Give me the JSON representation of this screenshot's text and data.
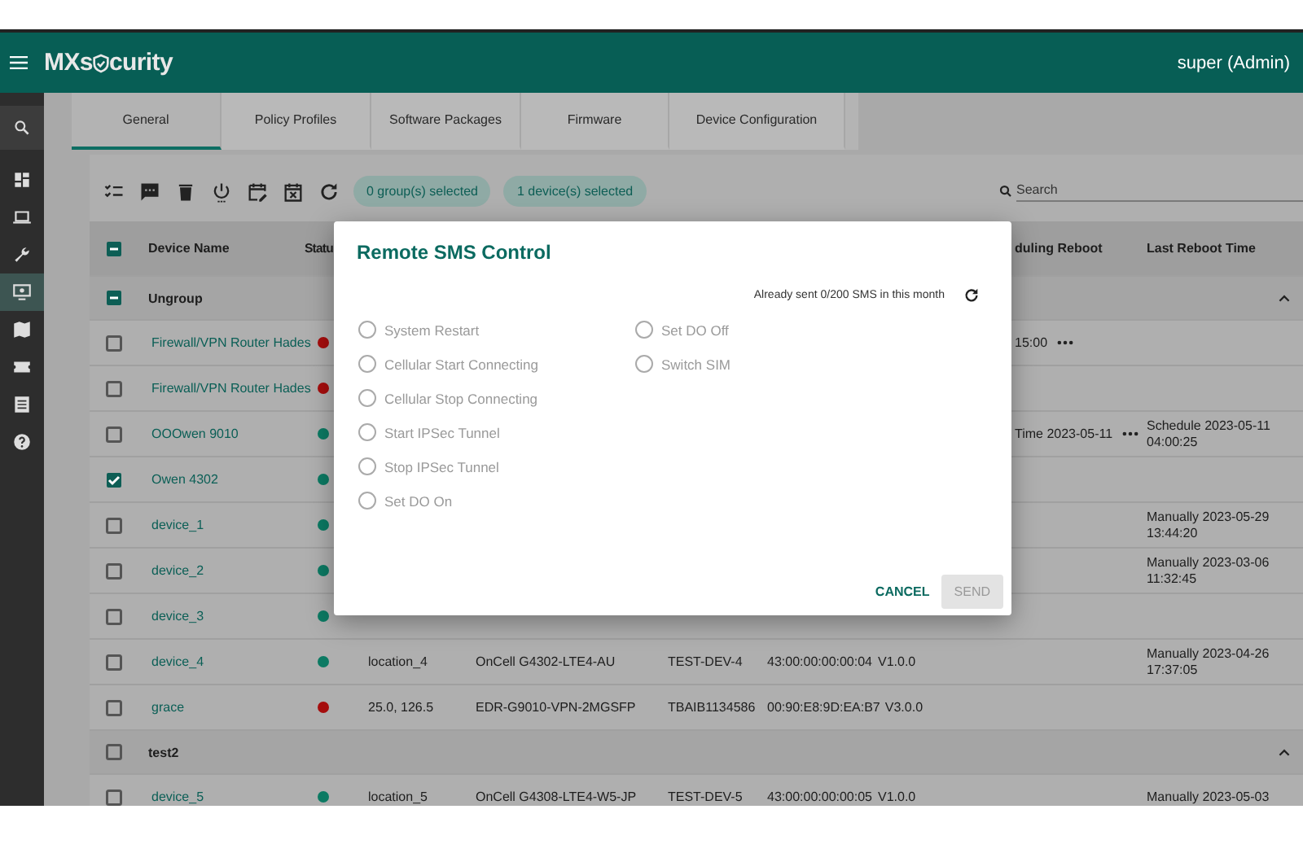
{
  "header": {
    "logo_start": "MXs",
    "logo_end": "curity",
    "user": "super (Admin)"
  },
  "sidebar": {
    "items": [
      {
        "kind": "search",
        "selected": false
      },
      {
        "kind": "dashboard",
        "selected": false
      },
      {
        "kind": "laptop",
        "selected": false
      },
      {
        "kind": "wrench",
        "selected": false
      },
      {
        "kind": "monitor",
        "selected": true
      },
      {
        "kind": "map",
        "selected": false
      },
      {
        "kind": "ticket",
        "selected": false
      },
      {
        "kind": "list",
        "selected": false
      },
      {
        "kind": "help",
        "selected": false
      }
    ]
  },
  "tabs": [
    {
      "label": "General",
      "selected": true
    },
    {
      "label": "Policy Profiles",
      "selected": false
    },
    {
      "label": "Software Packages",
      "selected": false
    },
    {
      "label": "Firmware",
      "selected": false
    },
    {
      "label": "Device Configuration",
      "selected": false
    }
  ],
  "toolbar": {
    "tools": [
      {
        "kind": "checklist"
      },
      {
        "kind": "message"
      },
      {
        "kind": "trash"
      },
      {
        "kind": "power"
      },
      {
        "kind": "calendar-edit"
      },
      {
        "kind": "calendar-x"
      },
      {
        "kind": "refresh"
      }
    ],
    "chips": [
      "0 group(s) selected",
      "1 device(s) selected"
    ],
    "search": {
      "placeholder": "Search"
    }
  },
  "table": {
    "header_checkbox": {
      "checked": true,
      "mixed": true
    },
    "columns": [
      "Device Name",
      "Statu",
      "duling Reboot",
      "Last Reboot Time"
    ],
    "groups": [
      {
        "name": "Ungroup",
        "checked": true,
        "mixed": true,
        "expanded": true,
        "rows": [
          {
            "name": "Firewall/VPN Router Hades",
            "checked": false,
            "color": "#a50d0d",
            "scheduling": "15:00",
            "menu": true
          },
          {
            "name": "Firewall/VPN Router Hades",
            "checked": false,
            "color": "#a50d0d"
          },
          {
            "name": "OOOwen 9010",
            "checked": false,
            "color": "#0c7a63",
            "scheduling": "Time 2023-05-11",
            "menu": true,
            "last_reboot": "Schedule 2023-05-11 04:00:25"
          },
          {
            "name": "Owen 4302",
            "checked": true,
            "color": "#0c7a63"
          },
          {
            "name": "device_1",
            "checked": false,
            "color": "#0c7a63",
            "last_reboot": "Manually 2023-05-29 13:44:20"
          },
          {
            "name": "device_2",
            "checked": false,
            "color": "#0c7a63",
            "last_reboot": "Manually 2023-03-06 11:32:45"
          },
          {
            "name": "device_3",
            "checked": false,
            "color": "#0c7a63"
          },
          {
            "name": "device_4",
            "checked": false,
            "color": "#0c7a63",
            "location": "location_4",
            "model": "OnCell G4302-LTE4-AU",
            "serial": "TEST-DEV-4",
            "mac": "43:00:00:00:00:04",
            "version": "V1.0.0",
            "last_reboot": "Manually 2023-04-26 17:37:05"
          },
          {
            "name": "grace",
            "checked": false,
            "color": "#a50d0d",
            "location": "25.0, 126.5",
            "model": "EDR-G9010-VPN-2MGSFP",
            "serial": "TBAIB1134586",
            "mac": "00:90:E8:9D:EA:B7",
            "version": "V3.0.0"
          }
        ]
      },
      {
        "name": "test2",
        "checked": false,
        "expanded": true,
        "rows": [
          {
            "name": "device_5",
            "checked": false,
            "color": "#0c7a63",
            "location": "location_5",
            "model": "OnCell G4308-LTE4-W5-JP",
            "serial": "TEST-DEV-5",
            "mac": "43:00:00:00:00:05",
            "version": "V1.0.0",
            "last_reboot": "Manually 2023-05-03"
          }
        ]
      }
    ]
  },
  "dialog": {
    "title": "Remote SMS Control",
    "quota": "Already sent 0/200 SMS in this month",
    "options": [
      {
        "label": "System Restart",
        "selected": false
      },
      {
        "label": "Cellular Start Connecting",
        "selected": false
      },
      {
        "label": "Cellular Stop Connecting",
        "selected": false
      },
      {
        "label": "Start IPSec Tunnel",
        "selected": false
      },
      {
        "label": "Stop IPSec Tunnel",
        "selected": false
      },
      {
        "label": "Set DO On",
        "selected": false
      },
      {
        "label": "Set DO Off",
        "selected": false
      },
      {
        "label": "Switch SIM",
        "selected": false
      }
    ],
    "cancel": "CANCEL",
    "send": {
      "label": "SEND",
      "disabled": true
    }
  }
}
